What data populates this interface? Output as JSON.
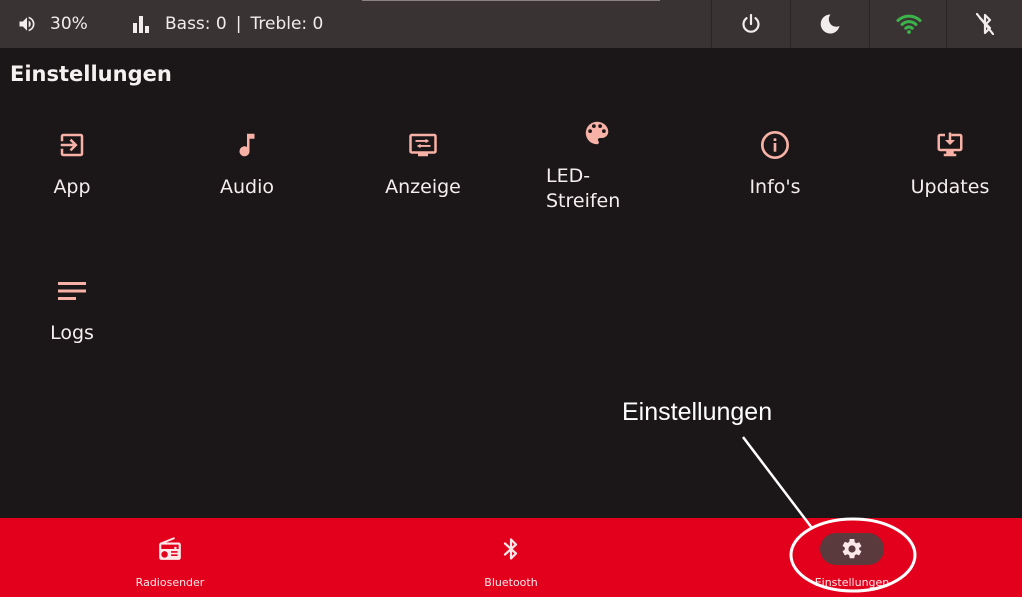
{
  "status": {
    "volume": "30%",
    "bass": "Bass: 0",
    "separator": "|",
    "treble": "Treble: 0"
  },
  "topbar_icons": [
    "power-icon",
    "moon-icon",
    "wifi-icon",
    "bluetooth-off-icon"
  ],
  "page": {
    "title": "Einstellungen"
  },
  "tiles": [
    {
      "label": "App",
      "icon": "exit-app-icon"
    },
    {
      "label": "Audio",
      "icon": "music-note-icon"
    },
    {
      "label": "Anzeige",
      "icon": "display-icon"
    },
    {
      "label": "LED-\nStreifen",
      "label_line1": "LED-",
      "label_line2": "Streifen",
      "icon": "palette-icon"
    },
    {
      "label": "Info's",
      "icon": "info-icon"
    },
    {
      "label": "Updates",
      "icon": "download-monitor-icon"
    },
    {
      "label": "Logs",
      "icon": "lines-icon"
    }
  ],
  "nav": [
    {
      "label": "Radiosender",
      "icon": "radio-icon"
    },
    {
      "label": "Bluetooth",
      "icon": "bluetooth-icon"
    },
    {
      "label": "Einstellungen",
      "icon": "gear-icon",
      "active": true
    }
  ],
  "annotation": {
    "text": "Einstellungen"
  },
  "colors": {
    "background": "#1b1617",
    "topbar": "#3a3334",
    "accent_icon": "#f7b1a7",
    "nav_bar": "#e3001c",
    "wifi": "#3cb34a"
  }
}
